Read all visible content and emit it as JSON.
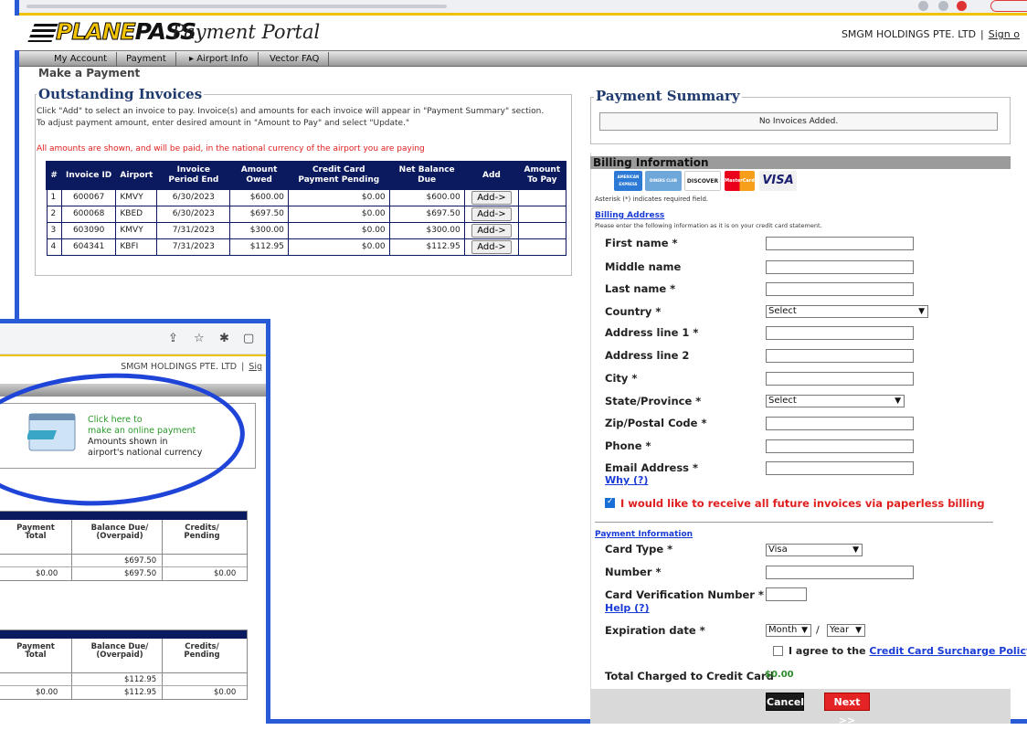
{
  "header": {
    "logo_part1": "PLANE",
    "logo_part2": "PASS",
    "portal_title": "Payment Portal",
    "company": "SMGM HOLDINGS PTE. LTD",
    "separator": "|",
    "signout": "Sign o"
  },
  "nav": {
    "items": [
      {
        "label": "My Account"
      },
      {
        "label": "Payment"
      },
      {
        "label": "▸ Airport Info"
      },
      {
        "label": "Vector FAQ"
      }
    ]
  },
  "page_title": "Make a Payment",
  "outstanding": {
    "legend": "Outstanding Invoices",
    "help_line1": "Click \"Add\" to select an invoice to pay. Invoice(s) and amounts for each invoice will appear in \"Payment Summary\" section.",
    "help_line2": "To adjust payment amount, enter desired amount in \"Amount to Pay\" and select \"Update.\"",
    "currency_note": "All amounts are shown, and will be paid, in the national currency of the airport you are paying",
    "columns": [
      "#",
      "Invoice ID",
      "Airport",
      "Invoice Period End",
      "Amount Owed",
      "Credit Card Payment Pending",
      "Net Balance Due",
      "Add",
      "Amount To Pay"
    ],
    "add_label": "Add->",
    "rows": [
      {
        "num": "1",
        "id": "600067",
        "airport": "KMVY",
        "period": "6/30/2023",
        "owed": "$600.00",
        "pending": "$0.00",
        "net": "$600.00"
      },
      {
        "num": "2",
        "id": "600068",
        "airport": "KBED",
        "period": "6/30/2023",
        "owed": "$697.50",
        "pending": "$0.00",
        "net": "$697.50"
      },
      {
        "num": "3",
        "id": "603090",
        "airport": "KMVY",
        "period": "7/31/2023",
        "owed": "$300.00",
        "pending": "$0.00",
        "net": "$300.00"
      },
      {
        "num": "4",
        "id": "604341",
        "airport": "KBFI",
        "period": "7/31/2023",
        "owed": "$112.95",
        "pending": "$0.00",
        "net": "$112.95"
      }
    ]
  },
  "summary": {
    "legend": "Payment Summary",
    "empty": "No Invoices Added."
  },
  "billing": {
    "header": "Billing Information",
    "cards": [
      "AMERICAN EXPRESS",
      "DINERS CLUB",
      "DISCOVER",
      "MasterCard",
      "VISA"
    ],
    "required_note": "Asterisk (*) indicates required field.",
    "address_heading": "Billing Address",
    "address_note": "Please enter the following information as it is on your credit card statement.",
    "fields": {
      "first": "First name *",
      "middle": "Middle name",
      "last": "Last name *",
      "country": "Country *",
      "addr1": "Address line 1 *",
      "addr2": "Address line 2",
      "city": "City *",
      "state": "State/Province *",
      "zip": "Zip/Postal Code *",
      "phone": "Phone *",
      "email": "Email Address *"
    },
    "select_placeholder": "Select",
    "why": "Why (?)",
    "paperless": "I would like to receive all future invoices via paperless billing"
  },
  "payment_info": {
    "heading": "Payment Information",
    "card_type_label": "Card Type *",
    "card_type_value": "Visa",
    "number_label": "Number *",
    "cvn_label": "Card Verification Number *",
    "help": "Help (?)",
    "exp_label": "Expiration date *",
    "exp_month": "Month",
    "exp_sep": "/",
    "exp_year": "Year",
    "agree_prefix": "I agree to the ",
    "agree_link": "Credit Card Surcharge Policy",
    "agree_suffix": " *",
    "total_label": "Total Charged to Credit Card",
    "total_value": "$0.00",
    "cancel": "Cancel",
    "next": "Next >>"
  },
  "inset": {
    "company": "SMGM HOLDINGS PTE. LTD",
    "separator": "|",
    "signout": "Sig",
    "promo_line1": "Click here to",
    "promo_line2": "make an online payment",
    "promo_line3": "Amounts shown in",
    "promo_line4": "airport's national currency",
    "columns": [
      "Payment Total",
      "Balance Due/ (Overpaid)",
      "Credits/ Pending"
    ],
    "tables": [
      {
        "balance": "$697.50",
        "total": "$0.00",
        "balance2": "$697.50",
        "credits": "$0.00"
      },
      {
        "balance": "$112.95",
        "total": "$0.00",
        "balance2": "$112.95",
        "credits": "$0.00"
      }
    ]
  }
}
